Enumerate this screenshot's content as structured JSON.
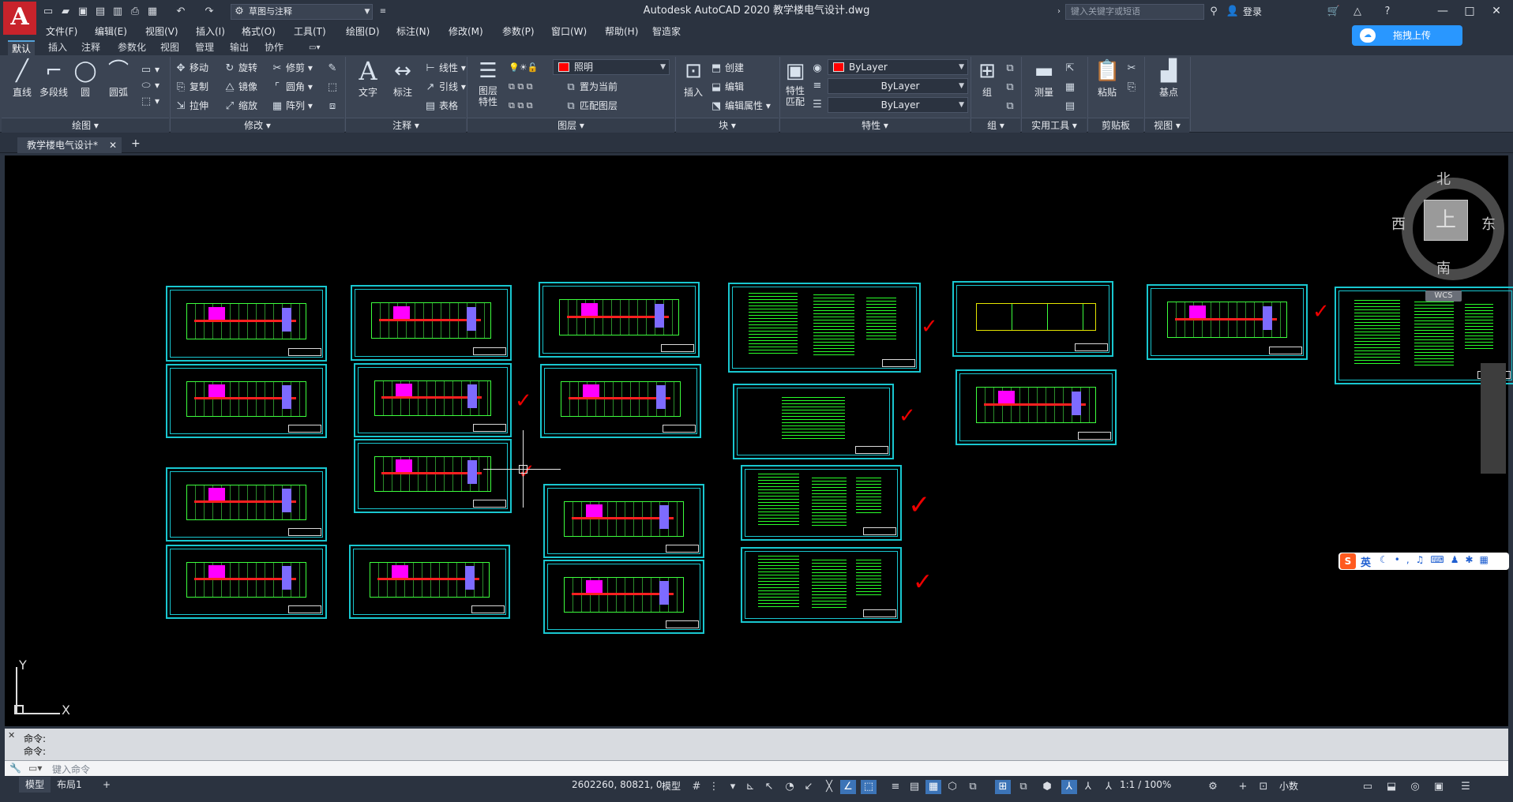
{
  "app": {
    "logo": "A",
    "title": "Autodesk AutoCAD 2020    教学楼电气设计.dwg",
    "workspace": "草图与注释",
    "search_placeholder": "键入关键字或短语",
    "login": "登录"
  },
  "menu": [
    "文件(F)",
    "编辑(E)",
    "视图(V)",
    "插入(I)",
    "格式(O)",
    "工具(T)",
    "绘图(D)",
    "标注(N)",
    "修改(M)",
    "参数(P)",
    "窗口(W)",
    "帮助(H)",
    "智造家"
  ],
  "ribbon_tabs": [
    "默认",
    "插入",
    "注释",
    "参数化",
    "视图",
    "管理",
    "输出",
    "协作"
  ],
  "ribbon": {
    "draw": {
      "title": "绘图",
      "line": "直线",
      "polyline": "多段线",
      "circle": "圆",
      "arc": "圆弧"
    },
    "modify": {
      "title": "修改",
      "move": "移动",
      "rotate": "旋转",
      "trim": "修剪",
      "copy": "复制",
      "mirror": "镜像",
      "fillet": "圆角",
      "stretch": "拉伸",
      "scale": "缩放",
      "array": "阵列"
    },
    "annotation": {
      "title": "注释",
      "text": "文字",
      "dimension": "标注",
      "linear": "线性",
      "leader": "引线",
      "table": "表格"
    },
    "layers": {
      "title": "图层",
      "properties": "图层\n特性",
      "current_layer": "照明",
      "set_current": "置为当前",
      "match_layer": "匹配图层"
    },
    "block": {
      "title": "块",
      "insert": "插入",
      "create": "创建",
      "edit": "编辑",
      "edit_attr": "编辑属性"
    },
    "properties": {
      "title": "特性",
      "match": "特性\n匹配",
      "color": "ByLayer",
      "linetype": "ByLayer",
      "lineweight": "ByLayer"
    },
    "groups": {
      "title": "组",
      "group": "组"
    },
    "utilities": {
      "title": "实用工具",
      "measure": "测量"
    },
    "clipboard": {
      "title": "剪贴板",
      "paste": "粘贴"
    },
    "view": {
      "title": "视图",
      "base": "基点"
    }
  },
  "file_tab": "教学楼电气设计*",
  "viewcube": {
    "top": "上",
    "north": "北",
    "south": "南",
    "east": "东",
    "west": "西",
    "wcs": "WCS"
  },
  "ucs": {
    "x": "X",
    "y": "Y"
  },
  "upload": "拖拽上传",
  "ime": {
    "lang": "英"
  },
  "command": {
    "history": [
      "命令:",
      "命令:"
    ],
    "placeholder": "键入命令"
  },
  "status": {
    "model_tab": "模型",
    "layout_tab": "布局1",
    "add": "+",
    "coords": "2602260, 80821, 0",
    "model": "模型",
    "scale": "1:1 / 100%",
    "units": "小数"
  },
  "colors": {
    "cyan_frame": "#19c7d0",
    "accent": "#56a3d9",
    "canvas": "#000000"
  }
}
